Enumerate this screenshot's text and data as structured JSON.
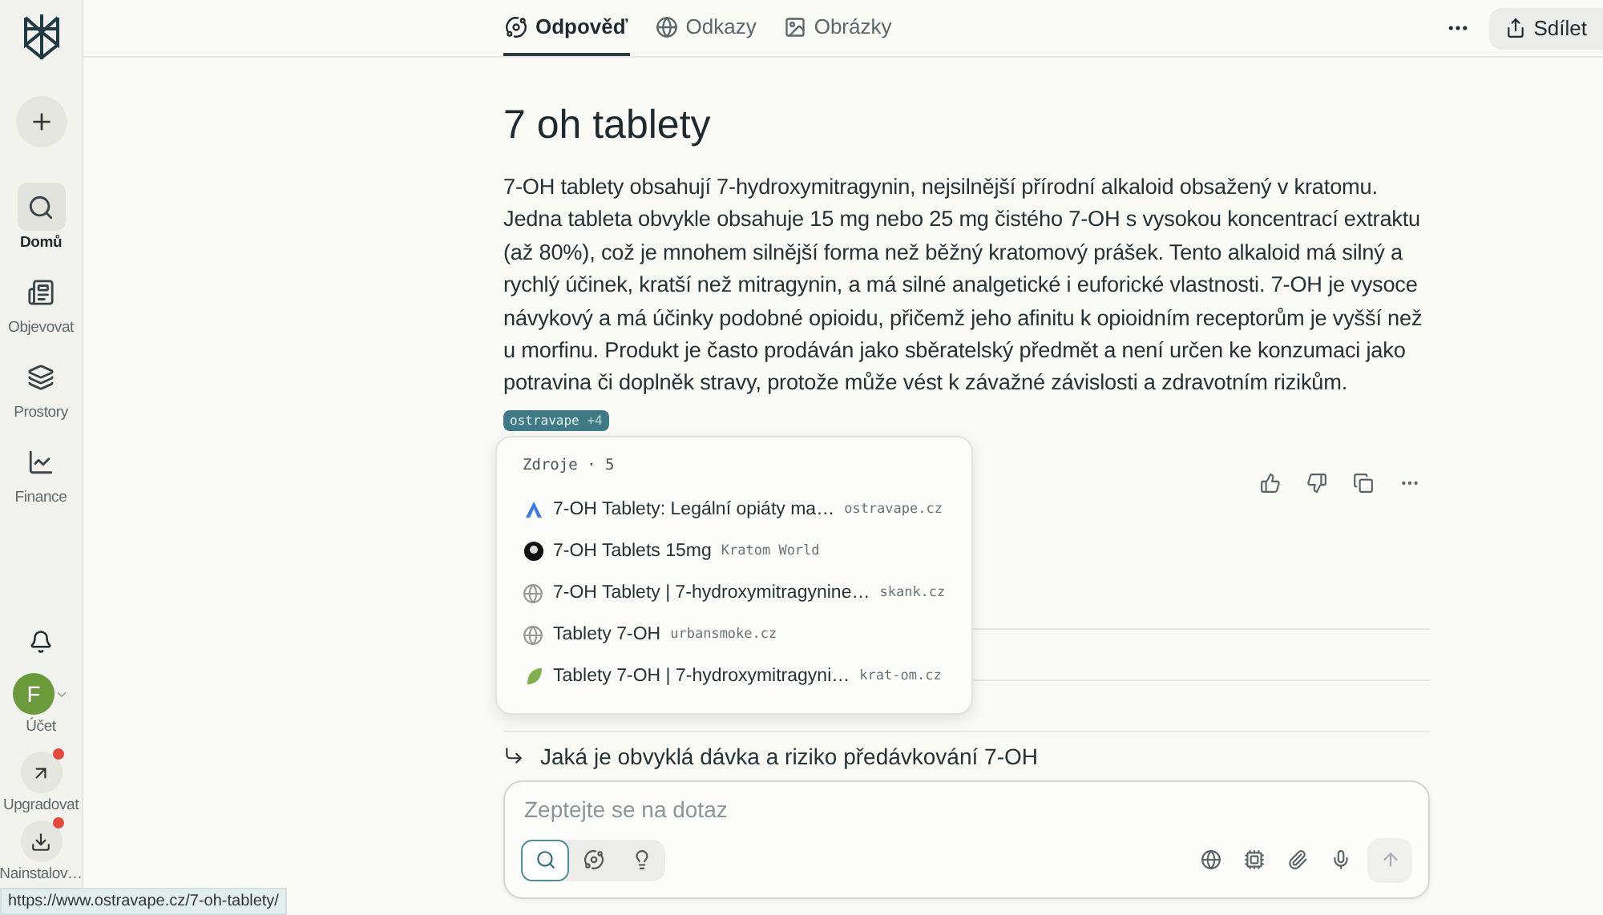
{
  "sidebar": {
    "items": [
      {
        "label": "Domů",
        "selected": true
      },
      {
        "label": "Objevovat",
        "selected": false
      },
      {
        "label": "Prostory",
        "selected": false
      },
      {
        "label": "Finance",
        "selected": false
      }
    ],
    "account": {
      "initial": "F",
      "label": "Účet"
    },
    "extras": [
      {
        "label": "Upgradovat",
        "badge": true
      },
      {
        "label": "Nainstalov…",
        "badge": true
      }
    ]
  },
  "tabs": [
    {
      "label": "Odpověď",
      "selected": true
    },
    {
      "label": "Odkazy",
      "selected": false
    },
    {
      "label": "Obrázky",
      "selected": false
    }
  ],
  "share_button": "Sdílet",
  "answer": {
    "title": "7 oh tablety",
    "text": "7-OH tablety obsahují 7-hydroxymitragynin, nejsilnější přírodní alkaloid obsažený v kratomu. Jedna tableta obvykle obsahuje 15 mg nebo 25 mg čistého 7-OH s vysokou koncentrací extraktu (až 80%), což je mnohem silnější forma než běžný kratomový prášek. Tento alkaloid má silný a rychlý účinek, kratší než mitragynin, a má silné analgetické i euforické vlastnosti. 7-OH je vysoce návykový a má účinky podobné opioidu, přičemž jeho afinitu k opioidním receptorům je vyšší než u morfinu. Produkt je často prodáván jako sběratelský předmět a není určen ke konzumaci jako potravina či doplněk stravy, protože může vést k závažné závislosti a zdravotním rizikům.",
    "citation": {
      "source": "ostravape",
      "more": "+4"
    }
  },
  "sources_popup": {
    "title": "Zdroje",
    "separator": "·",
    "count": "5",
    "items": [
      {
        "title": "7-OH Tablety: Legální opiáty ma…",
        "site": "ostravape.cz"
      },
      {
        "title": "7-OH Tablets 15mg",
        "site": "Kratom World"
      },
      {
        "title": "7-OH Tablety | 7-hydroxymitragynine…",
        "site": "skank.cz"
      },
      {
        "title": "Tablety 7-OH",
        "site": "urbansmoke.cz"
      },
      {
        "title": "Tablety 7-OH | 7-hydroxymitragyni…",
        "site": "krat-om.cz"
      }
    ]
  },
  "related": [
    "Jaká je obvyklá dávka a riziko předávkování 7-OH"
  ],
  "composer": {
    "placeholder": "Zeptejte se na dotaz",
    "modes": [
      {
        "selected": true
      },
      {
        "selected": false
      },
      {
        "selected": false
      }
    ],
    "send_disabled": true
  },
  "status_url": "https://www.ostravape.cz/7-oh-tablety/"
}
